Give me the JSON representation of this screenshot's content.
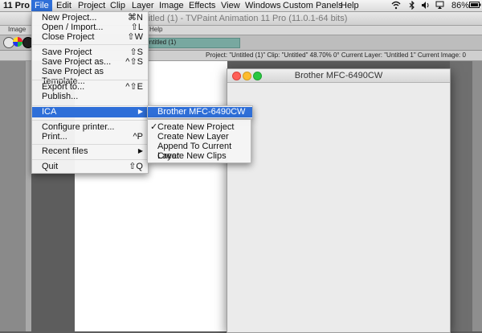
{
  "menubar": {
    "app": "11 Pro",
    "items": [
      "File",
      "Edit",
      "Project",
      "Clip",
      "Layer",
      "Image",
      "Effects",
      "View",
      "Windows",
      "Custom Panels",
      "Help"
    ],
    "battery": "86%"
  },
  "window": {
    "title": "Untitled (1) - TVPaint Animation 11 Pro (11.0.1-64 bits)",
    "app_menu": {
      "image": "Image",
      "help": "Help"
    },
    "project_tab": "Untitled (1)",
    "info": "Project: \"Untitled (1)\"  Clip: \"Untitled\"   48.70%   0°  Current Layer: \"Untitled 1\"  Current Image: 0"
  },
  "file_menu": {
    "new_project": "New Project...",
    "new_project_sc": "⌘N",
    "open_import": "Open / Import...",
    "open_import_sc": "⇧L",
    "close_project": "Close Project",
    "close_project_sc": "⇧W",
    "save_project": "Save Project",
    "save_project_sc": "⇧S",
    "save_project_as": "Save Project as...",
    "save_project_as_sc": "^⇧S",
    "save_template": "Save Project as Template...",
    "export_to": "Export to...",
    "export_to_sc": "^⇧E",
    "publish": "Publish...",
    "ica": "ICA",
    "ica_arrow": "▶",
    "configure_printer": "Configure printer...",
    "print": "Print...",
    "print_sc": "^P",
    "recent_files": "Recent files",
    "recent_arrow": "▶",
    "quit": "Quit",
    "quit_sc": "⇧Q"
  },
  "ica_menu": {
    "device": "Brother MFC-6490CW ...",
    "device_arrow": "▶"
  },
  "scanner_menu": {
    "checkmark": "✓",
    "create_project": "Create New Project",
    "create_layer": "Create New Layer",
    "append_layer": "Append To Current Layer",
    "create_clips": "Create New Clips"
  },
  "dialog": {
    "title": "Brother MFC-6490CW"
  }
}
